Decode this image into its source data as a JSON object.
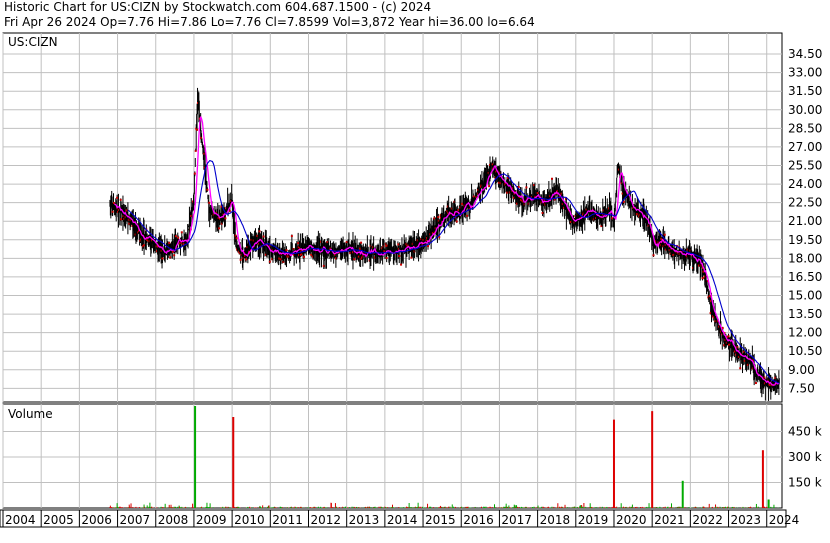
{
  "header": {
    "line1": "Historic Chart  for US:CIZN  by Stockwatch.com 604.687.1500 - (c) 2024",
    "line2": "Fri Apr 26 2024   Op=7.76   Hi=7.86   Lo=7.76   Cl=7.8599   Vol=3,872   Year hi=36.00   lo=6.64"
  },
  "colors": {
    "price_bar": "#000000",
    "down_mark": "#cc0000",
    "ma_short": "#ff00ff",
    "ma_long": "#0000cc",
    "volume_up": "#00aa00",
    "volume_down": "#dd0000",
    "grid": "#c0c0c0"
  },
  "chart_data": [
    {
      "type": "line",
      "label": "US:CIZN",
      "x": [
        2006.8,
        2007.2,
        2007.6,
        2008.0,
        2008.3,
        2008.6,
        2008.8,
        2009.0,
        2009.1,
        2009.25,
        2009.4,
        2009.6,
        2009.8,
        2010.0,
        2010.1,
        2010.3,
        2010.6,
        2011.0,
        2011.4,
        2011.7,
        2012.0,
        2012.5,
        2013.0,
        2013.5,
        2014.0,
        2014.5,
        2015.0,
        2015.3,
        2015.6,
        2016.0,
        2016.4,
        2016.8,
        2017.0,
        2017.3,
        2017.6,
        2017.9,
        2018.2,
        2018.5,
        2018.8,
        2019.0,
        2019.3,
        2019.6,
        2019.9,
        2020.0,
        2020.1,
        2020.25,
        2020.5,
        2020.8,
        2021.0,
        2021.3,
        2021.6,
        2022.0,
        2022.3,
        2022.6,
        2022.9,
        2023.2,
        2023.6,
        2023.9,
        2024.1,
        2024.33
      ],
      "y": [
        22.3,
        21.5,
        20.0,
        19.0,
        18.3,
        19.5,
        19.2,
        23.0,
        31.0,
        26.5,
        22.0,
        21.0,
        21.8,
        22.5,
        19.0,
        18.2,
        19.5,
        18.8,
        18.2,
        18.6,
        18.9,
        18.5,
        18.8,
        18.3,
        18.6,
        18.8,
        19.2,
        20.5,
        21.5,
        21.8,
        23.0,
        25.5,
        24.5,
        23.5,
        22.5,
        23.0,
        22.5,
        23.5,
        21.5,
        20.8,
        21.8,
        21.3,
        22.0,
        20.5,
        25.5,
        23.5,
        22.0,
        21.5,
        19.5,
        19.2,
        18.5,
        18.3,
        17.5,
        13.5,
        11.5,
        10.5,
        9.5,
        7.8,
        7.9,
        7.85
      ],
      "ylim": [
        6.4,
        36.2
      ],
      "xlim": [
        2004,
        2024.4
      ],
      "yticks": [
        "34.50",
        "33.00",
        "31.50",
        "30.00",
        "28.50",
        "27.00",
        "25.50",
        "24.00",
        "22.50",
        "21.00",
        "19.50",
        "18.00",
        "16.50",
        "15.00",
        "13.50",
        "12.00",
        "10.50",
        "9.00",
        "7.50"
      ],
      "ytick_values": [
        34.5,
        33.0,
        31.5,
        30.0,
        28.5,
        27.0,
        25.5,
        24.0,
        22.5,
        21.0,
        19.5,
        18.0,
        16.5,
        15.0,
        13.5,
        12.0,
        10.5,
        9.0,
        7.5
      ],
      "xticks": [
        "2004",
        "2005",
        "2006",
        "2007",
        "2008",
        "2009",
        "2010",
        "2011",
        "2012",
        "2013",
        "2014",
        "2015",
        "2016",
        "2017",
        "2018",
        "2019",
        "2020",
        "2021",
        "2022",
        "2023",
        "2024"
      ],
      "grid": true
    },
    {
      "type": "bar",
      "label": "Volume",
      "yticks": [
        "450 k",
        "300 k",
        "150 k"
      ],
      "ytick_values": [
        450,
        300,
        150
      ],
      "ylim": [
        0,
        600
      ],
      "spikes": [
        {
          "x": 2009.03,
          "v": 600,
          "dir": "up"
        },
        {
          "x": 2010.03,
          "v": 535,
          "dir": "down"
        },
        {
          "x": 2020.0,
          "v": 520,
          "dir": "down"
        },
        {
          "x": 2021.0,
          "v": 570,
          "dir": "down"
        },
        {
          "x": 2021.8,
          "v": 160,
          "dir": "up"
        },
        {
          "x": 2023.9,
          "v": 340,
          "dir": "down"
        },
        {
          "x": 2024.05,
          "v": 50,
          "dir": "up"
        }
      ],
      "grid": true
    }
  ]
}
